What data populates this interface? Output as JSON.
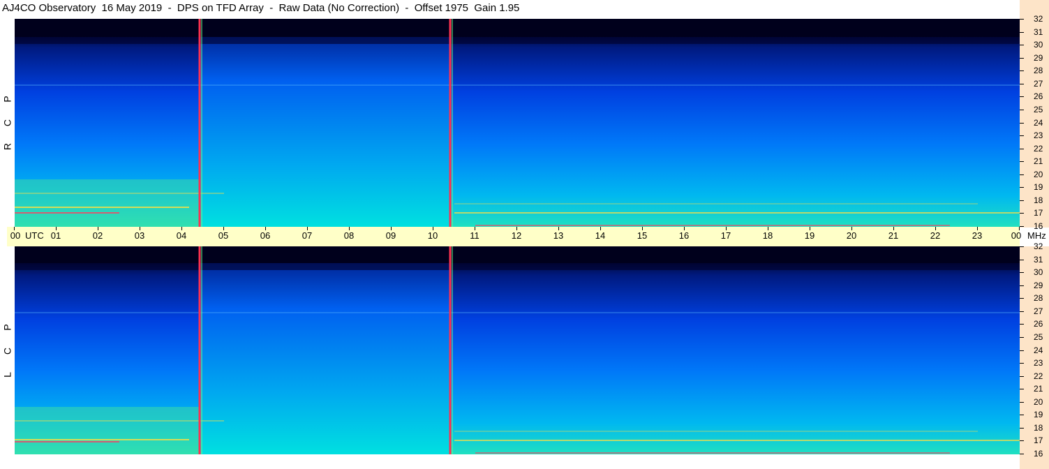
{
  "window": {
    "title": "AJ4CO Observatory  16 May 2019  -  DPS on TFD Array  -  Raw Data (No Correction)  -  Offset 1975  Gain 1.95"
  },
  "polarizations": {
    "top": [
      "R",
      "C",
      "P"
    ],
    "bottom": [
      "L",
      "C",
      "P"
    ]
  },
  "time_axis": {
    "ticks": [
      "00",
      "01",
      "02",
      "03",
      "04",
      "05",
      "06",
      "07",
      "08",
      "09",
      "10",
      "11",
      "12",
      "13",
      "14",
      "15",
      "16",
      "17",
      "18",
      "19",
      "20",
      "21",
      "22",
      "23",
      "00"
    ],
    "start_unit": "UTC",
    "end_unit": "MHz"
  },
  "freq_axis": {
    "ticks": [
      "32",
      "31",
      "30",
      "29",
      "28",
      "27",
      "26",
      "25",
      "24",
      "23",
      "22",
      "21",
      "20",
      "19",
      "18",
      "17",
      "16"
    ]
  },
  "colors": {
    "background_low": "#00008b",
    "background_mid": "#0050ff",
    "background_high": "#00e0e8",
    "interference_marker": "#ff3050",
    "axis_fill_time": "#ffffc8",
    "axis_fill_freq": "#fde4c8"
  }
}
